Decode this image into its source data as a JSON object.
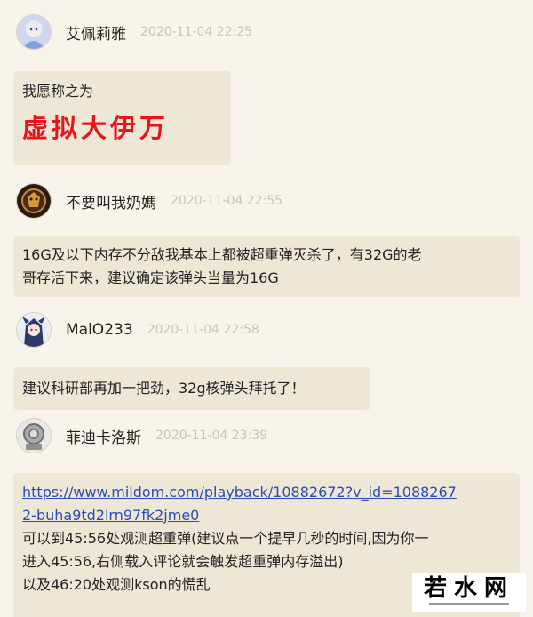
{
  "comments": [
    {
      "username": "艾佩莉雅",
      "time": "2020-11-04 22:25",
      "line1": "我愿称之为",
      "big_text": "虚拟大伊万"
    },
    {
      "username": "不要叫我奶媽",
      "time": "2020-11-04 22:55",
      "line1": "16G及以下内存不分敌我基本上都被超重弹灭杀了，有32G的老",
      "line2": "哥存活下来，建议确定该弹头当量为16G"
    },
    {
      "username": "MalO233",
      "time": "2020-11-04 22:58",
      "line1": "建议科研部再加一把劲，32g核弹头拜托了！"
    },
    {
      "username": "菲迪卡洛斯",
      "time": "2020-11-04 23:39",
      "link1": "https://www.mildom.com/playback/10882672?v_id=1088267",
      "link2": "2-buha9td2lrn97fk2jme0",
      "line1": "可以到45:56处观测超重弹(建议点一个提早几秒的时间,因为你一",
      "line2": "进入45:56,右侧载入评论就会触发超重弹内存溢出)",
      "line3": "以及46:20处观测kson的慌乱"
    }
  ],
  "watermark": {
    "text": "若水网"
  },
  "colors": {
    "background": "#f8f4ec",
    "bubble": "#efe7d6",
    "highlight": "#e8141a",
    "link": "#2b4bb5",
    "timestamp": "#c9c3b8"
  }
}
